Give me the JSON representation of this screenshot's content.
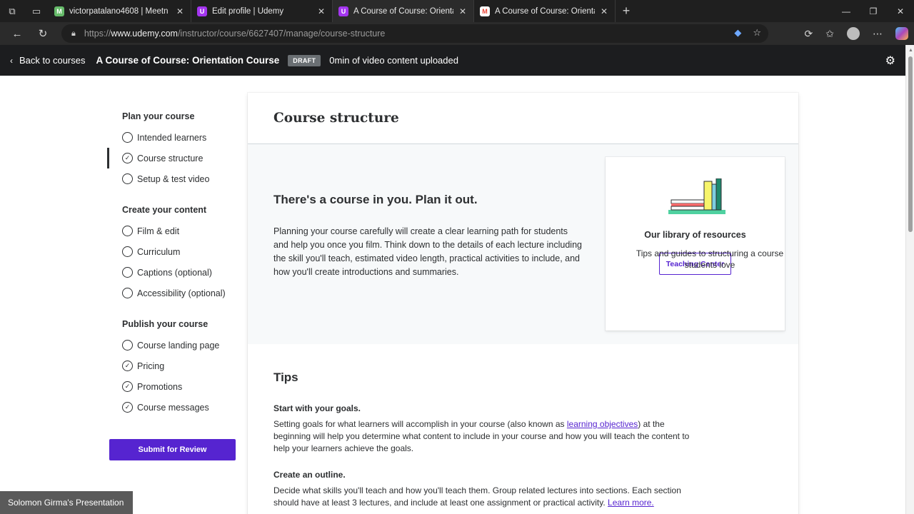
{
  "browser": {
    "tabs": [
      {
        "title": "victorpatalano4608 | Meetn",
        "icon": "meetn-icon",
        "icon_color": "#66bb6a",
        "active": false
      },
      {
        "title": "Edit profile | Udemy",
        "icon": "udemy-icon",
        "icon_color": "#a435f0",
        "active": false
      },
      {
        "title": "A Course of Course: Orientation C",
        "icon": "udemy-icon",
        "icon_color": "#a435f0",
        "active": true
      },
      {
        "title": "A Course of Course: Orientation C",
        "icon": "gmail-icon",
        "icon_color": "#ea4335",
        "active": false
      }
    ],
    "url_prefix": "https://",
    "url_host": "www.udemy.com",
    "url_path": "/instructor/course/6627407/manage/course-structure"
  },
  "header": {
    "back_label": "Back to courses",
    "course_title": "A Course of Course: Orientation Course",
    "status_badge": "DRAFT",
    "upload_status": "0min of video content uploaded"
  },
  "sidebar": {
    "sections": [
      {
        "title": "Plan your course",
        "items": [
          {
            "label": "Intended learners",
            "checked": false,
            "active": false
          },
          {
            "label": "Course structure",
            "checked": true,
            "active": true
          },
          {
            "label": "Setup & test video",
            "checked": false,
            "active": false
          }
        ]
      },
      {
        "title": "Create your content",
        "items": [
          {
            "label": "Film & edit",
            "checked": false,
            "active": false
          },
          {
            "label": "Curriculum",
            "checked": false,
            "active": false
          },
          {
            "label": "Captions (optional)",
            "checked": false,
            "active": false
          },
          {
            "label": "Accessibility (optional)",
            "checked": false,
            "active": false
          }
        ]
      },
      {
        "title": "Publish your course",
        "items": [
          {
            "label": "Course landing page",
            "checked": false,
            "active": false
          },
          {
            "label": "Pricing",
            "checked": true,
            "active": false
          },
          {
            "label": "Promotions",
            "checked": true,
            "active": false
          },
          {
            "label": "Course messages",
            "checked": true,
            "active": false
          }
        ]
      }
    ],
    "submit_label": "Submit for Review"
  },
  "main": {
    "page_title": "Course structure",
    "hero_title": "There's a course in you. Plan it out.",
    "hero_text": "Planning your course carefully will create a clear learning path for students and help you once you film. Think down to the details of each lecture including the skill you'll teach, estimated video length, practical activities to include, and how you'll create introductions and summaries.",
    "library": {
      "title": "Our library of resources",
      "description": "Tips and guides to structuring a course students love",
      "button_label": "Teaching Center"
    },
    "tips_title": "Tips",
    "tips": [
      {
        "title": "Start with your goals.",
        "text_before": "Setting goals for what learners will accomplish in your course (also known as ",
        "link": "learning objectives",
        "text_after": ") at the beginning will help you determine what content to include in your course and how you will teach the content to help your learners achieve the goals."
      },
      {
        "title": "Create an outline.",
        "text_before": "Decide what skills you'll teach and how you'll teach them. Group related lectures into sections. Each section should have at least 3 lectures, and include at least one assignment or practical activity. ",
        "link": "Learn more.",
        "text_after": ""
      }
    ]
  },
  "overlay": {
    "presenter_label": "Solomon Girma's Presentation"
  },
  "colors": {
    "accent": "#5624d0",
    "header_bg": "#1c1d1f",
    "hero_bg": "#f7f9fa"
  }
}
